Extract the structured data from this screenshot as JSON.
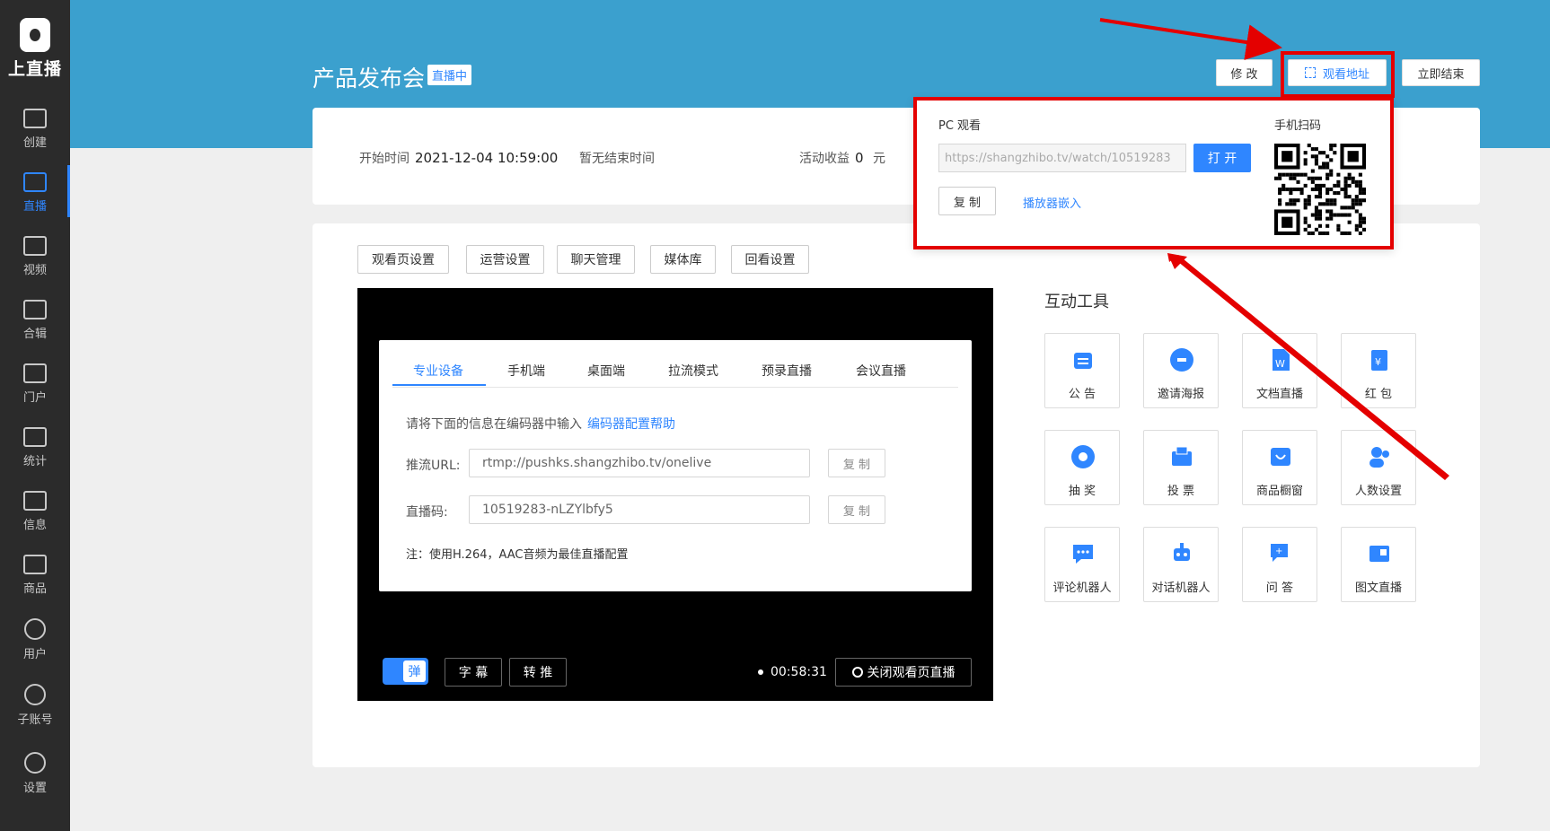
{
  "sidebar": {
    "logo": "上直播",
    "items": [
      {
        "label": "创建",
        "icon": "plus-square-icon"
      },
      {
        "label": "直播",
        "icon": "play-screen-icon"
      },
      {
        "label": "视频",
        "icon": "film-icon"
      },
      {
        "label": "合辑",
        "icon": "wallet-icon"
      },
      {
        "label": "门户",
        "icon": "grid-box-icon"
      },
      {
        "label": "统计",
        "icon": "line-chart-icon"
      },
      {
        "label": "信息",
        "icon": "mail-icon"
      },
      {
        "label": "商品",
        "icon": "shopping-bag-icon"
      },
      {
        "label": "用户",
        "icon": "user-icon"
      },
      {
        "label": "子账号",
        "icon": "users-icon"
      },
      {
        "label": "设置",
        "icon": "gear-icon"
      }
    ],
    "active": "直播"
  },
  "header": {
    "title": "产品发布会",
    "badge": "直播中",
    "edit_label": "修 改",
    "watch_label": "观看地址",
    "end_label": "立即结束"
  },
  "info": {
    "start_label": "开始时间",
    "start_value": "2021-12-04 10:59:00",
    "end_text": "暂无结束时间",
    "revenue_label": "活动收益",
    "revenue_value": "0",
    "revenue_unit": "元"
  },
  "tabs": [
    "观看页设置",
    "运营设置",
    "聊天管理",
    "媒体库",
    "回看设置"
  ],
  "stream": {
    "tabs": [
      "专业设备",
      "手机端",
      "桌面端",
      "拉流模式",
      "预录直播",
      "会议直播"
    ],
    "hint": "请将下面的信息在编码器中输入",
    "hint_link": "编码器配置帮助",
    "push_label": "推流URL:",
    "push_value": "rtmp://pushks.shangzhibo.tv/onelive",
    "code_label": "直播码:",
    "code_value": "10519283-nLZYlbfy5",
    "copy_label": "复 制",
    "note": "注：使用H.264，AAC音频为最佳直播配置"
  },
  "controls": {
    "danmu": "弹",
    "subtitle": "字 幕",
    "relay": "转 推",
    "timer": "00:58:31",
    "close_label": "关闭观看页直播"
  },
  "tools": {
    "title": "互动工具",
    "items": [
      {
        "label": "公 告",
        "icon": "announcement-icon"
      },
      {
        "label": "邀请海报",
        "icon": "invite-icon"
      },
      {
        "label": "文档直播",
        "icon": "word-doc-icon"
      },
      {
        "label": "红 包",
        "icon": "red-packet-icon"
      },
      {
        "label": "抽 奖",
        "icon": "lottery-wheel-icon"
      },
      {
        "label": "投 票",
        "icon": "vote-icon"
      },
      {
        "label": "商品橱窗",
        "icon": "shop-window-icon"
      },
      {
        "label": "人数设置",
        "icon": "people-icon"
      },
      {
        "label": "评论机器人",
        "icon": "comment-bot-icon"
      },
      {
        "label": "对话机器人",
        "icon": "robot-icon"
      },
      {
        "label": "问 答",
        "icon": "qa-icon"
      },
      {
        "label": "图文直播",
        "icon": "image-text-icon"
      }
    ],
    "accent": "#2f86ff"
  },
  "popup": {
    "pc_label": "PC 观看",
    "url": "https://shangzhibo.tv/watch/10519283",
    "open_label": "打 开",
    "copy_label": "复 制",
    "embed_label": "播放器嵌入",
    "qr_label": "手机扫码"
  },
  "colors": {
    "header": "#3ba0ce",
    "sidebar": "#2b2b2b",
    "accent": "#2f86ff",
    "annotation": "#e40000"
  }
}
